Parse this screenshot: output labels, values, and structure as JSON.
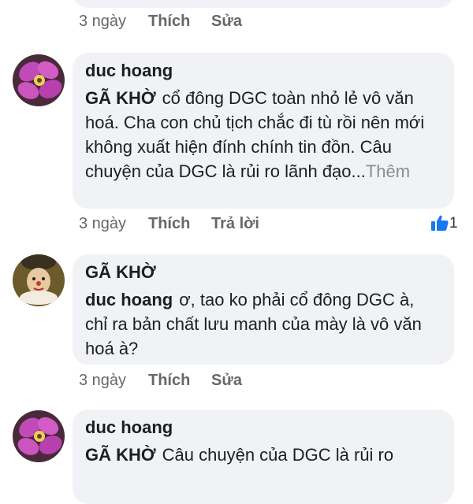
{
  "comments": [
    {
      "author": "",
      "reply_to": "",
      "text": "",
      "more": "",
      "actions": {
        "time": "3 ngày",
        "like": "Thích",
        "second": "Sửa"
      },
      "reaction_count": ""
    },
    {
      "author": "duc hoang",
      "reply_to": "GÃ KHỜ",
      "text": "cổ đông DGC toàn nhỏ lẻ vô văn hoá. Cha con chủ tịch chắc đi tù rồi nên mới không xuất hiện đính chính tin đồn. Câu chuyện của DGC là rủi ro lãnh đạo...",
      "more": "Thêm",
      "actions": {
        "time": "3 ngày",
        "like": "Thích",
        "second": "Trả lời"
      },
      "reaction_count": "1",
      "avatar_icon": "pink-flower-avatar"
    },
    {
      "author": "GÃ KHỜ",
      "reply_to": "duc hoang",
      "text": "ơ, tao ko phải cổ đông DGC à, chỉ ra bản chất lưu manh của mày là vô văn hoá à?",
      "more": "",
      "actions": {
        "time": "3 ngày",
        "like": "Thích",
        "second": "Sửa"
      },
      "reaction_count": "",
      "avatar_icon": "clown-avatar"
    },
    {
      "author": "duc hoang",
      "reply_to": "GÃ KHỜ",
      "text": "Câu chuyện của DGC là rủi ro",
      "more": "",
      "actions": {},
      "reaction_count": "",
      "avatar_icon": "pink-flower-avatar"
    }
  ],
  "colors": {
    "bubble": "#f0f2f5",
    "action_text": "#65676b",
    "like_blue": "#1877f2"
  }
}
